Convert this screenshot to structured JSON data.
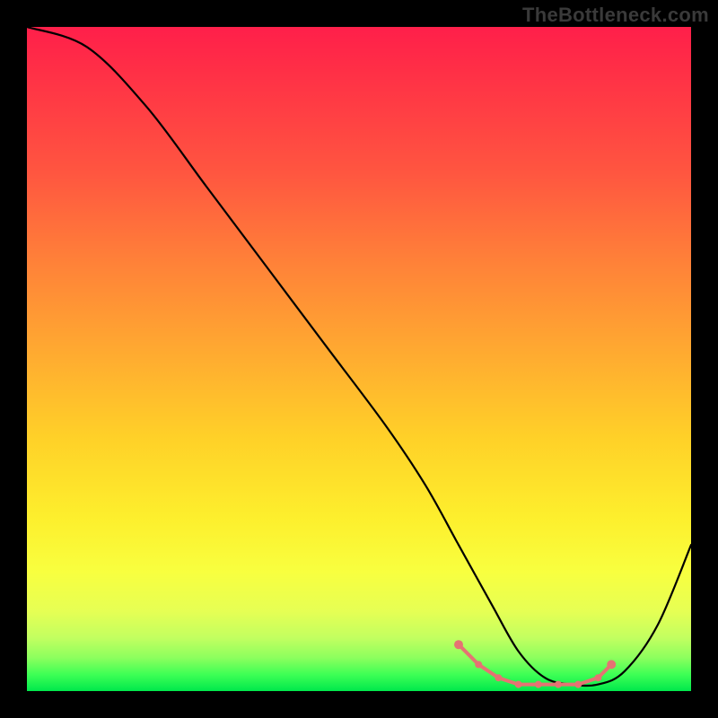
{
  "watermark": "TheBottleneck.com",
  "chart_data": {
    "type": "line",
    "title": "",
    "xlabel": "",
    "ylabel": "",
    "xlim": [
      0,
      100
    ],
    "ylim": [
      0,
      100
    ],
    "x": [
      0,
      9,
      18,
      27,
      36,
      45,
      54,
      60,
      65,
      70,
      74,
      78,
      82,
      86,
      90,
      95,
      100
    ],
    "values": [
      100,
      97,
      88,
      76,
      64,
      52,
      40,
      31,
      22,
      13,
      6,
      2,
      1,
      1,
      3,
      10,
      22
    ],
    "gradient_meaning": "background_color_scale_red_to_green",
    "markers": {
      "color": "#e57373",
      "x": [
        65,
        68,
        71,
        74,
        77,
        80,
        83,
        86,
        88
      ],
      "values": [
        7,
        4,
        2,
        1,
        1,
        1,
        1,
        2,
        4
      ]
    }
  }
}
